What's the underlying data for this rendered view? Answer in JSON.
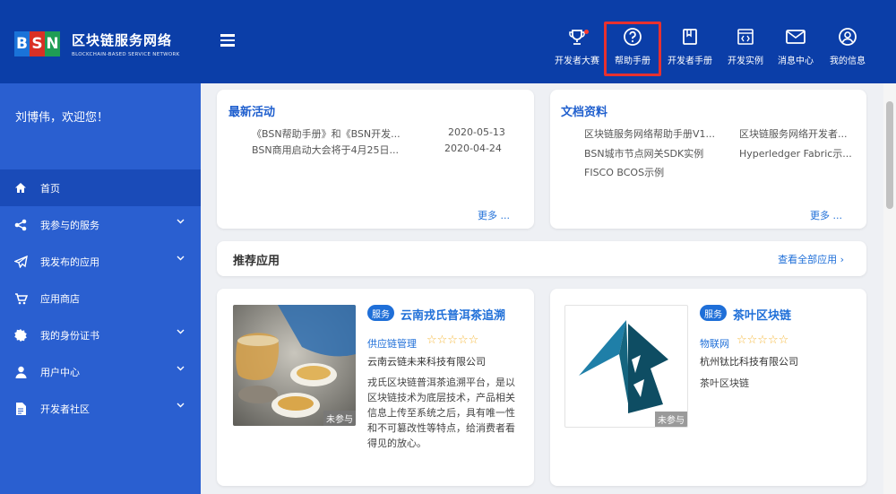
{
  "brand": {
    "title": "区块链服务网络",
    "subtitle": "BLOCKCHAIN-BASED SERVICE NETWORK",
    "logo_letters": [
      "B",
      "S",
      "N"
    ]
  },
  "nav": [
    {
      "label": "开发者大赛",
      "icon": "trophy-icon"
    },
    {
      "label": "帮助手册",
      "icon": "help-circle-icon"
    },
    {
      "label": "开发者手册",
      "icon": "book-icon"
    },
    {
      "label": "开发实例",
      "icon": "code-icon"
    },
    {
      "label": "消息中心",
      "icon": "mail-icon"
    },
    {
      "label": "我的信息",
      "icon": "user-circle-icon"
    }
  ],
  "sidebar": {
    "welcome": "刘博伟，欢迎您！",
    "items": [
      {
        "label": "首页",
        "icon": "home-icon",
        "active": true
      },
      {
        "label": "我参与的服务",
        "icon": "share-icon"
      },
      {
        "label": "我发布的应用",
        "icon": "send-icon"
      },
      {
        "label": "应用商店",
        "icon": "cart-icon"
      },
      {
        "label": "我的身份证书",
        "icon": "certificate-icon"
      },
      {
        "label": "用户中心",
        "icon": "user-icon"
      },
      {
        "label": "开发者社区",
        "icon": "document-icon"
      }
    ]
  },
  "activities": {
    "title": "最新活动",
    "rows": [
      {
        "text": "《BSN帮助手册》和《BSN开发...",
        "date": "2020-05-13"
      },
      {
        "text": "BSN商用启动大会将于4月25日...",
        "date": "2020-04-24"
      }
    ],
    "more": "更多 ..."
  },
  "docs": {
    "title": "文档资料",
    "items": [
      "区块链服务网络帮助手册V1...",
      "区块链服务网络开发者...",
      "BSN城市节点网关SDK实例",
      "Hyperledger Fabric示...",
      "FISCO BCOS示例"
    ],
    "more": "更多 ..."
  },
  "recommended": {
    "title": "推荐应用",
    "view_all": "查看全部应用 ›"
  },
  "apps": [
    {
      "badge": "服务",
      "name": "云南戎氏普洱茶追溯",
      "category": "供应链管理",
      "stars": "☆☆☆☆☆",
      "company": "云南云链未来科技有限公司",
      "desc": "戎氏区块链普洱茶追溯平台，是以区块链技术为底层技术，产品相关信息上传至系统之后，具有唯一性和不可篡改性等特点，给消费者看得见的放心。",
      "ribbon": "未参与"
    },
    {
      "badge": "服务",
      "name": "茶叶区块链",
      "category": "物联网",
      "stars": "☆☆☆☆☆",
      "company": "杭州钛比科技有限公司",
      "desc": "茶叶区块链",
      "ribbon": "未参与"
    }
  ],
  "colors": {
    "header": "#0b3ea8",
    "sidebar": "#2a5fd0",
    "accent": "#1f6fd8",
    "highlight": "#e8312f"
  }
}
